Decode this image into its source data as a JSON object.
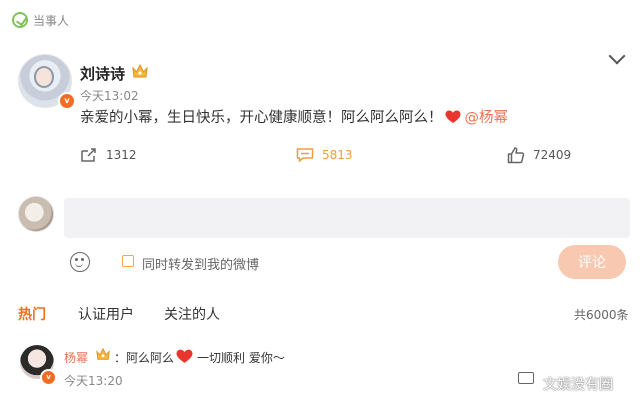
{
  "header": {
    "label": "当事人"
  },
  "post": {
    "author": "刘诗诗",
    "time": "今天13:02",
    "text": "亲爱的小幂，生日快乐，开心健康顺意！阿么阿么阿么！",
    "mention": "@杨幂",
    "reposts": "1312",
    "comments": "5813",
    "likes": "72409"
  },
  "compose": {
    "placeholder": "",
    "repost_label": "同时转发到我的微博",
    "submit_label": "评论"
  },
  "tabs": [
    {
      "label": "热门"
    },
    {
      "label": "认证用户"
    },
    {
      "label": "关注的人"
    }
  ],
  "total_count": "共6000条",
  "reply": {
    "author": "杨幂",
    "text_before": "：阿么阿么",
    "text_after": "一切顺利 爱你～",
    "time": "今天13:20"
  },
  "watermark": "文娱没有圈",
  "colors": {
    "accent": "#f26d21",
    "mention": "#eb7350",
    "comment_button": "#f8c8b1",
    "input_bg": "#f2f2f5"
  }
}
